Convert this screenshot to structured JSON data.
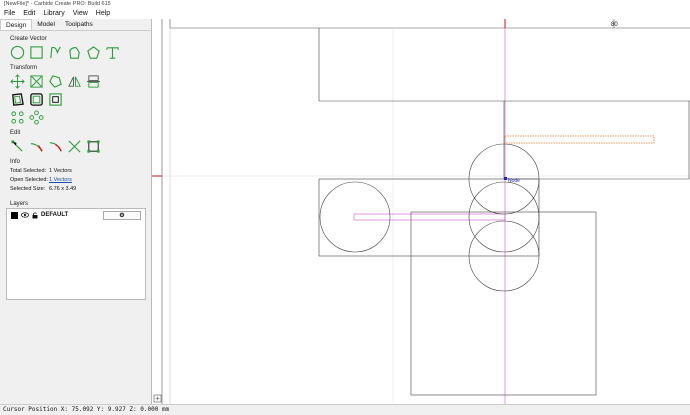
{
  "window": {
    "title": "[NewFile]* - Carbide Create PRO: Build 615"
  },
  "menu": {
    "items": [
      "File",
      "Edit",
      "Library",
      "View",
      "Help"
    ]
  },
  "tabs": [
    "Design",
    "Model",
    "Toolpaths"
  ],
  "create_vector": {
    "title": "Create Vector",
    "tools": [
      "circle-icon",
      "rectangle-icon",
      "curve-icon",
      "polygon-icon",
      "pentagon-icon",
      "text-icon"
    ]
  },
  "transform": {
    "title": "Transform",
    "tools_row1": [
      "move-icon",
      "scale-icon",
      "rotate-icon",
      "mirror-icon",
      "align-icon"
    ],
    "tools_row2": [
      "offset-icon",
      "boolean-icon",
      "bounding-box-icon"
    ],
    "tools_row3": [
      "array-icon",
      "circular-array-icon"
    ]
  },
  "edit": {
    "title": "Edit",
    "tools": [
      "node-edit-icon",
      "trim-icon",
      "fillet-icon",
      "cut-icon",
      "join-icon"
    ]
  },
  "info": {
    "title": "Info",
    "total_selected_label": "Total Selected:",
    "total_selected_value": "1 Vectors",
    "open_selected_label": "Open Selected:",
    "open_selected_value": "1 Vectors",
    "selected_size_label": "Selected Size:",
    "selected_size_value": "6.76 x 3.49"
  },
  "layers": {
    "title": "Layers",
    "items": [
      {
        "name": "DEFAULT",
        "color": "#000000"
      }
    ]
  },
  "canvas": {
    "ruler_label": "80",
    "node_label": "Node"
  },
  "status": {
    "text": "Cursor Position X: 75.092 Y: 9.927 Z: 0.000 mm"
  },
  "colors": {
    "accent_green": "#2e9e3a",
    "selection_orange": "#e8742a",
    "guide_magenta": "#cc55cc",
    "ruler_red": "#cc1111"
  }
}
